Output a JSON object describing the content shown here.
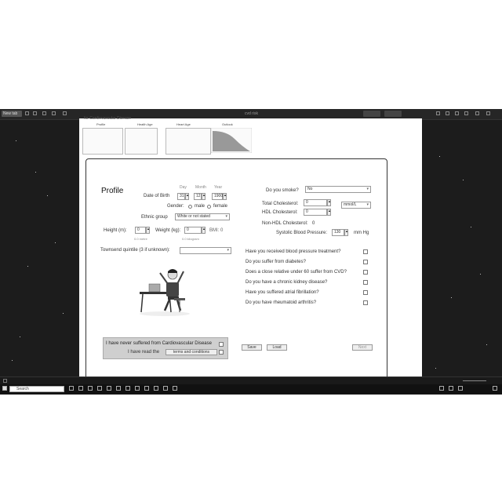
{
  "app": {
    "tab_label": "New tab",
    "window_title": "cvd risk"
  },
  "header": {
    "partial_title": "for Cardiovascular Disease",
    "steps": [
      "Profile",
      "Health Age",
      "Heart Age",
      "Outlook"
    ]
  },
  "profile": {
    "title": "Profile",
    "dob_label": "Date of Birth",
    "day_label": "Day",
    "month_label": "Month",
    "year_label": "Year",
    "day_value": "31",
    "month_value": "12",
    "year_value": "1900",
    "gender_label": "Gender:",
    "gender_male": "male",
    "gender_female": "female",
    "ethnic_label": "Ethnic group",
    "ethnic_value": "White or not stated",
    "height_label": "Height (m):",
    "height_value": "0",
    "height_hint": "0.0 metre",
    "weight_label": "Weight (kg):",
    "weight_value": "0",
    "weight_hint": "0.0 kilogram",
    "bmi_label": "BMI: 0",
    "quintile_label": "Townsend quintile (3 if unknown):",
    "quintile_value": ""
  },
  "right": {
    "smoke_label": "Do you smoke?",
    "smoke_value": "No",
    "total_chol_label": "Total Cholesterol:",
    "total_chol_value": "0",
    "unit_value": "mmol/L",
    "hdl_label": "HDL Cholesterol:",
    "hdl_value": "0",
    "nonhdl_label": "Non-HDL Cholesterol:",
    "nonhdl_value": "0",
    "sbp_label": "Systolic Blood Pressure:",
    "sbp_value": "130",
    "sbp_unit": "mm Hg",
    "questions": [
      "Have you received blood pressure treatment?",
      "Do you suffer from diabetes?",
      "Does a close relative under 60 suffer from CVD?",
      "Do you have a chronic kidney disease?",
      "Have you suffered atrial fibrillation?",
      "Do you have rheumatoid arthritis?"
    ]
  },
  "consent": {
    "line1": "I have never suffered from Cardiovascular Disease",
    "line2_prefix": "I have read the",
    "terms_button": "terms and conditions"
  },
  "actions": {
    "save": "Save",
    "load": "Load",
    "next": "Next"
  },
  "taskbar": {
    "search_placeholder": "Search"
  }
}
